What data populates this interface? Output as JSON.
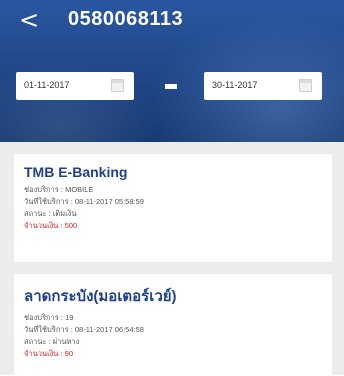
{
  "header": {
    "back_glyph": "<",
    "title": "0580068113",
    "date_from": "01-11-2017",
    "date_to": "30-11-2017"
  },
  "transactions": [
    {
      "title": "TMB E-Banking",
      "service": "ช่องบริการ : MOBILE",
      "datetime": "วันที่ใช้บริการ : 08-11-2017 05:58:59",
      "status": "สถานะ : เติมเงิน",
      "amount": "จำนวนเงิน : 500"
    },
    {
      "title": "ลาดกระบัง(มอเตอร์เวย์)",
      "service": "ช่องบริการ : 19",
      "datetime": "วันที่ใช้บริการ : 08-11-2017 06:54:58",
      "status": "สถานะ : ผ่านทาง",
      "amount": "จำนวนเงิน : 90"
    }
  ],
  "colors": {
    "header": "#21498c",
    "title_text": "#1f3f8f",
    "amount_text": "#e02020"
  },
  "icons": {
    "back": "chevron-left-icon",
    "calendar": "calendar-icon"
  }
}
